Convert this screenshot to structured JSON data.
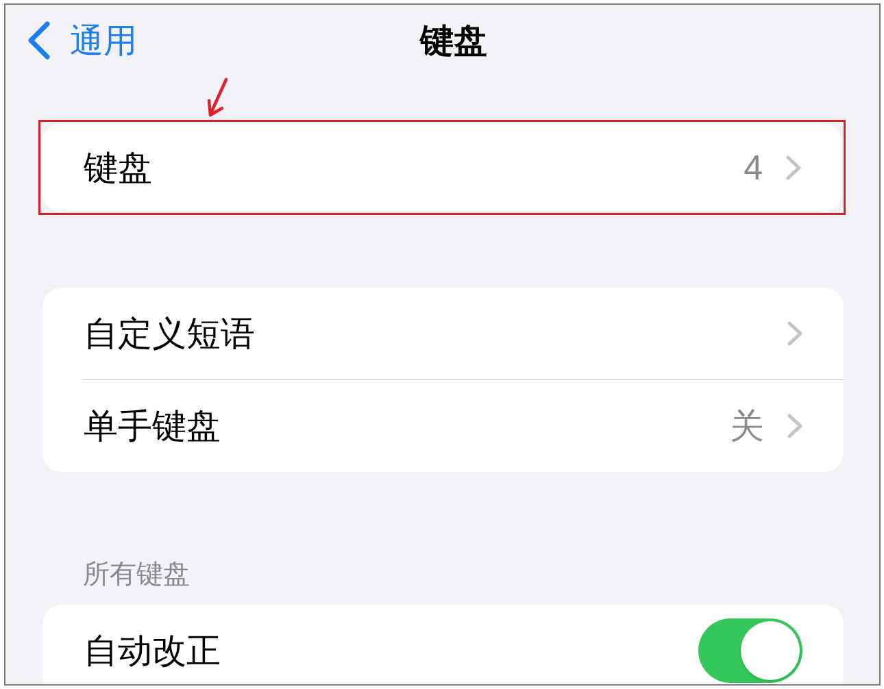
{
  "nav": {
    "back_label": "通用",
    "title": "键盘"
  },
  "groups": [
    {
      "highlighted": true,
      "rows": [
        {
          "kind": "link",
          "label": "键盘",
          "value": "4"
        }
      ]
    },
    {
      "highlighted": false,
      "rows": [
        {
          "kind": "link",
          "label": "自定义短语"
        },
        {
          "kind": "link",
          "label": "单手键盘",
          "value": "关"
        }
      ]
    },
    {
      "highlighted": false,
      "header": "所有键盘",
      "rows": [
        {
          "kind": "toggle",
          "label": "自动改正",
          "on": true
        }
      ]
    }
  ]
}
